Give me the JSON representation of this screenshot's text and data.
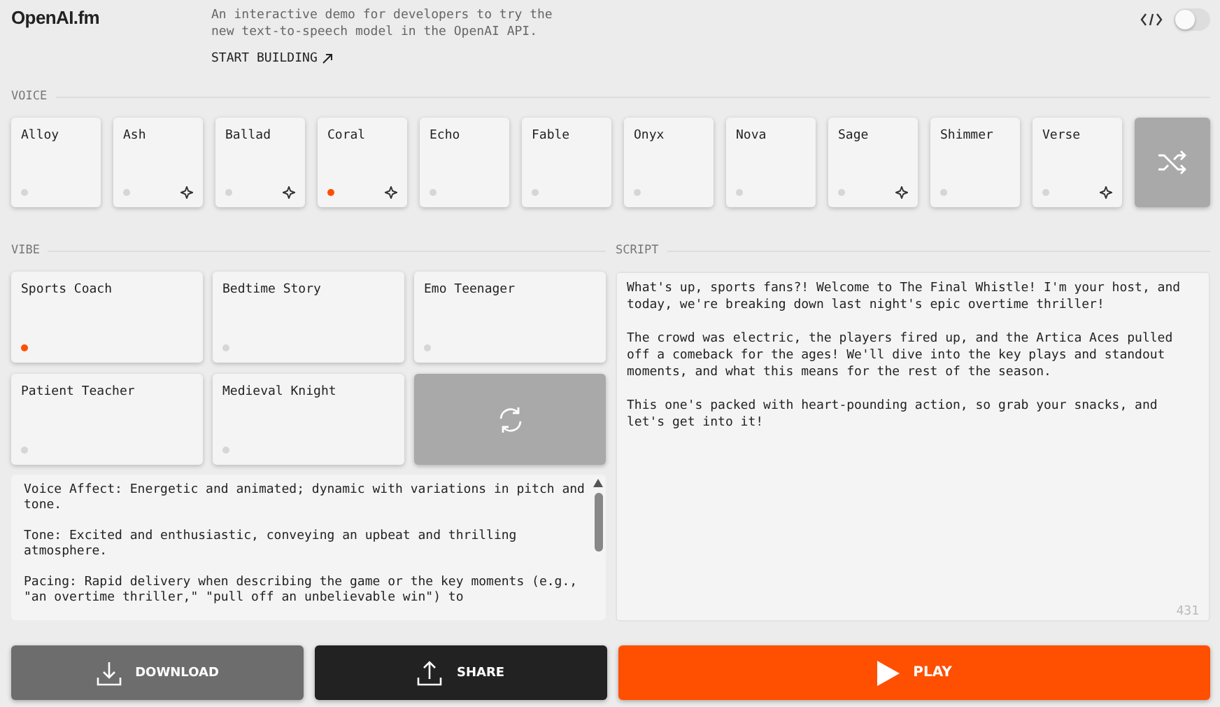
{
  "header": {
    "logo": "OpenAI.fm",
    "description": "An interactive demo for developers to try the new text-to-speech model in the OpenAI API.",
    "link": "START BUILDING",
    "code_toggle": {
      "on": false
    }
  },
  "voice": {
    "label": "VOICE",
    "items": [
      {
        "name": "Alloy",
        "selected": false,
        "featured": false
      },
      {
        "name": "Ash",
        "selected": false,
        "featured": true
      },
      {
        "name": "Ballad",
        "selected": false,
        "featured": true
      },
      {
        "name": "Coral",
        "selected": true,
        "featured": true
      },
      {
        "name": "Echo",
        "selected": false,
        "featured": false
      },
      {
        "name": "Fable",
        "selected": false,
        "featured": false
      },
      {
        "name": "Onyx",
        "selected": false,
        "featured": false
      },
      {
        "name": "Nova",
        "selected": false,
        "featured": false
      },
      {
        "name": "Sage",
        "selected": false,
        "featured": true
      },
      {
        "name": "Shimmer",
        "selected": false,
        "featured": false
      },
      {
        "name": "Verse",
        "selected": false,
        "featured": true
      }
    ]
  },
  "vibe": {
    "label": "VIBE",
    "items": [
      {
        "name": "Sports Coach",
        "selected": true
      },
      {
        "name": "Bedtime Story",
        "selected": false
      },
      {
        "name": "Emo Teenager",
        "selected": false
      },
      {
        "name": "Patient Teacher",
        "selected": false
      },
      {
        "name": "Medieval Knight",
        "selected": false
      }
    ],
    "instructions": [
      "Voice Affect: Energetic and animated; dynamic with variations in pitch and tone.",
      "Tone: Excited and enthusiastic, conveying an upbeat and thrilling atmosphere.",
      "Pacing: Rapid delivery when describing the game or the key moments (e.g., \"an overtime thriller,\" \"pull off an unbelievable win\") to"
    ]
  },
  "script": {
    "label": "SCRIPT",
    "paragraphs": [
      "What's up, sports fans?! Welcome to The Final Whistle! I'm your host, and today, we're breaking down last night's epic overtime thriller!",
      "The crowd was electric, the players fired up, and the Artica Aces pulled off a comeback for the ages! We'll dive into the key plays and standout moments, and what this means for the rest of the season.",
      "This one's packed with heart-pounding action, so grab your snacks, and let's get into it!"
    ],
    "count": "431"
  },
  "actions": [
    {
      "label": "DOWNLOAD",
      "kind": "download"
    },
    {
      "label": "SHARE",
      "kind": "share"
    },
    {
      "label": "PLAY",
      "kind": "play"
    }
  ]
}
